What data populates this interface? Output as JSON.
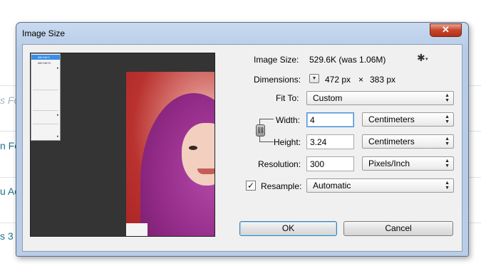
{
  "background": {
    "snippets": [
      "s Fo",
      "n Fo",
      "u Ac",
      "s 3"
    ]
  },
  "dialog": {
    "title": "Image Size",
    "close_glyph": "✕",
    "image_size_label": "Image Size:",
    "image_size_value": "529.6K (was 1.06M)",
    "gear_icon": "gear-icon",
    "gear_glyph": "✱",
    "dimensions_label": "Dimensions:",
    "dimensions_width": "472 px",
    "dimensions_sep": "×",
    "dimensions_height": "383 px",
    "fit_to_label": "Fit To:",
    "fit_to_value": "Custom",
    "width_label": "Width:",
    "width_value": "4",
    "width_unit": "Centimeters",
    "height_label": "Height:",
    "height_value": "3.24",
    "height_unit": "Centimeters",
    "resolution_label": "Resolution:",
    "resolution_value": "300",
    "resolution_unit": "Pixels/Inch",
    "resample_label": "Resample:",
    "resample_checked": true,
    "resample_check_glyph": "✓",
    "resample_value": "Automatic",
    "ok_label": "OK",
    "cancel_label": "Cancel"
  },
  "preview_menu": {
    "items": [
      "Alt+Ctrl+I",
      "Alt+Ctrl+C"
    ]
  },
  "colors": {
    "title_bar": "#b9cde7",
    "client": "#f0f0f0",
    "close_button": "#c8452b",
    "focus_border": "#4f91d8"
  }
}
